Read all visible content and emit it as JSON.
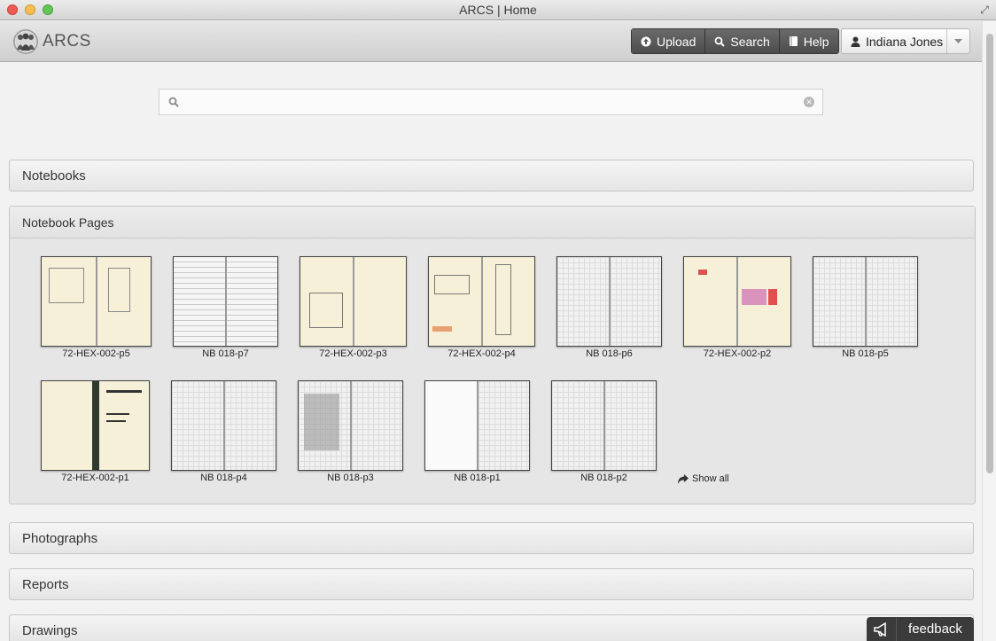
{
  "window": {
    "title": "ARCS | Home"
  },
  "brand": {
    "name": "ARCS",
    "logo_icon": "people-group-icon"
  },
  "nav": {
    "buttons": [
      {
        "label": "Upload",
        "icon": "upload-icon"
      },
      {
        "label": "Search",
        "icon": "search-icon"
      },
      {
        "label": "Help",
        "icon": "book-icon"
      }
    ],
    "user": {
      "name": "Indiana Jones",
      "icon": "user-icon"
    }
  },
  "search": {
    "value": "",
    "placeholder": ""
  },
  "sections": {
    "notebooks": "Notebooks",
    "notebook_pages": "Notebook Pages",
    "photographs": "Photographs",
    "reports": "Reports",
    "drawings": "Drawings"
  },
  "notebook_pages": [
    "72-HEX-002-p5",
    "NB 018-p7",
    "72-HEX-002-p3",
    "72-HEX-002-p4",
    "NB 018-p6",
    "72-HEX-002-p2",
    "NB 018-p5",
    "72-HEX-002-p1",
    "NB 018-p4",
    "NB 018-p3",
    "NB 018-p1",
    "NB 018-p2"
  ],
  "show_all": "Show all",
  "feedback": {
    "label": "feedback",
    "icon": "megaphone-icon"
  },
  "colors": {
    "nav_button": "#555555",
    "feedback_bg": "#3b3b3b",
    "paper_cream": "#f6f0d8"
  }
}
